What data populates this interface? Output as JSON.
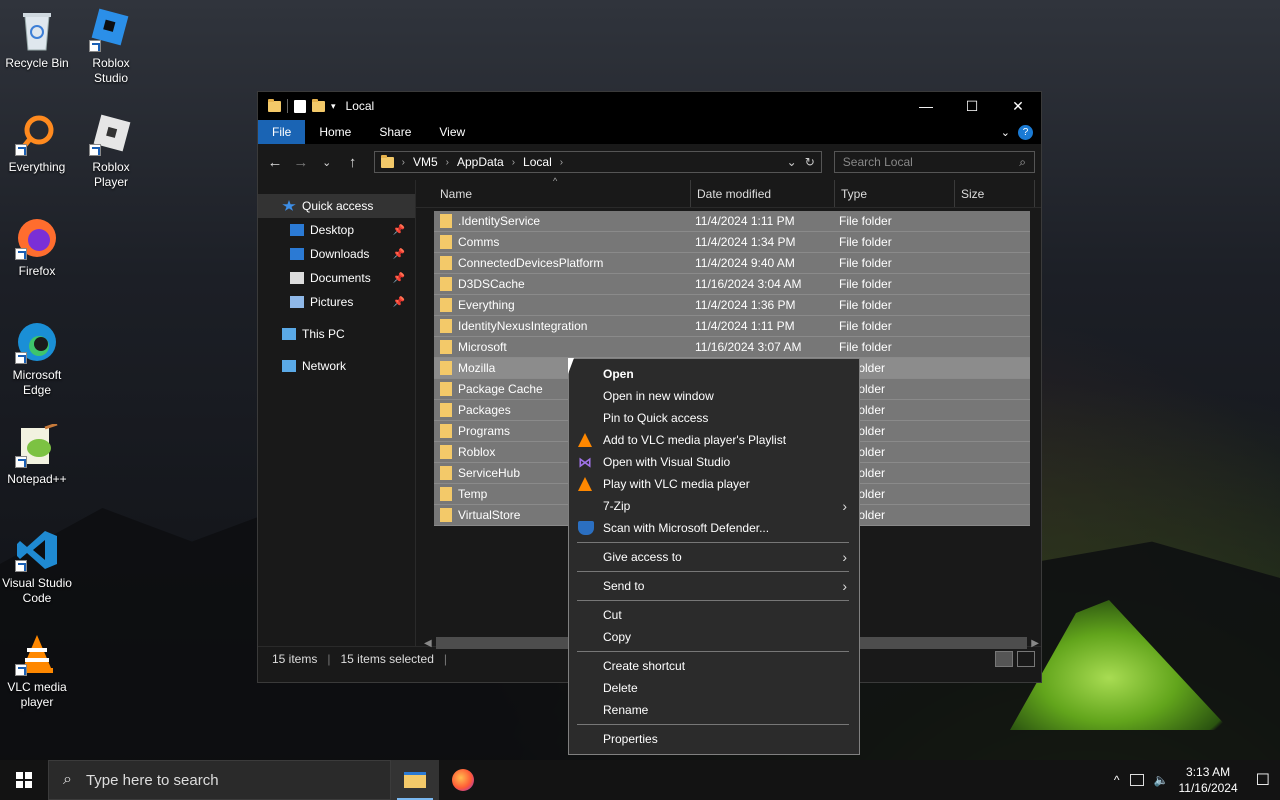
{
  "desktop": {
    "icons": [
      {
        "label": "Recycle Bin",
        "icon": "recycle-bin-icon"
      },
      {
        "label": "Roblox Studio",
        "icon": "roblox-studio-icon"
      },
      {
        "label": "Everything",
        "icon": "everything-icon"
      },
      {
        "label": "Roblox Player",
        "icon": "roblox-player-icon"
      },
      {
        "label": "Firefox",
        "icon": "firefox-icon"
      },
      {
        "label": "Microsoft Edge",
        "icon": "edge-icon"
      },
      {
        "label": "Notepad++",
        "icon": "notepadpp-icon"
      },
      {
        "label": "Visual Studio Code",
        "icon": "vscode-icon"
      },
      {
        "label": "VLC media player",
        "icon": "vlc-icon"
      }
    ]
  },
  "window": {
    "title": "Local",
    "controls": {
      "minimize": "—",
      "maximize": "☐",
      "close": "✕"
    },
    "ribbon": {
      "tabs": [
        "File",
        "Home",
        "Share",
        "View"
      ]
    },
    "nav": {
      "back": "←",
      "forward": "→",
      "recent": "⌄",
      "up": "↑"
    },
    "address": {
      "crumbs": [
        "VM5",
        "AppData",
        "Local"
      ],
      "dropdown": "⌄",
      "refresh": "↻"
    },
    "search": {
      "placeholder": "Search Local",
      "icon": "⌕"
    },
    "sidebar": {
      "items": [
        {
          "label": "Quick access",
          "icon": "star-icon",
          "pinned": false
        },
        {
          "label": "Desktop",
          "icon": "desktop-icon",
          "pinned": true
        },
        {
          "label": "Downloads",
          "icon": "download-icon",
          "pinned": true
        },
        {
          "label": "Documents",
          "icon": "documents-icon",
          "pinned": true
        },
        {
          "label": "Pictures",
          "icon": "pictures-icon",
          "pinned": true
        },
        {
          "label": "This PC",
          "icon": "pc-icon",
          "pinned": false
        },
        {
          "label": "Network",
          "icon": "network-icon",
          "pinned": false
        }
      ],
      "pin_glyph": "📌"
    },
    "columns": [
      "Name",
      "Date modified",
      "Type",
      "Size"
    ],
    "files": [
      {
        "name": ".IdentityService",
        "date": "11/4/2024 1:11 PM",
        "type": "File folder"
      },
      {
        "name": "Comms",
        "date": "11/4/2024 1:34 PM",
        "type": "File folder"
      },
      {
        "name": "ConnectedDevicesPlatform",
        "date": "11/4/2024 9:40 AM",
        "type": "File folder"
      },
      {
        "name": "D3DSCache",
        "date": "11/16/2024 3:04 AM",
        "type": "File folder"
      },
      {
        "name": "Everything",
        "date": "11/4/2024 1:36 PM",
        "type": "File folder"
      },
      {
        "name": "IdentityNexusIntegration",
        "date": "11/4/2024 1:11 PM",
        "type": "File folder"
      },
      {
        "name": "Microsoft",
        "date": "11/16/2024 3:07 AM",
        "type": "File folder"
      },
      {
        "name": "Mozilla",
        "date": "",
        "type": "folder"
      },
      {
        "name": "Package Cache",
        "date": "",
        "type": "folder"
      },
      {
        "name": "Packages",
        "date": "",
        "type": "folder"
      },
      {
        "name": "Programs",
        "date": "",
        "type": "folder"
      },
      {
        "name": "Roblox",
        "date": "",
        "type": "folder"
      },
      {
        "name": "ServiceHub",
        "date": "",
        "type": "folder"
      },
      {
        "name": "Temp",
        "date": "",
        "type": "folder"
      },
      {
        "name": "VirtualStore",
        "date": "",
        "type": "folder"
      }
    ],
    "status": {
      "count": "15 items",
      "selected": "15 items selected"
    }
  },
  "context_menu": {
    "items": [
      {
        "label": "Open",
        "bold": true
      },
      {
        "label": "Open in new window"
      },
      {
        "label": "Pin to Quick access"
      },
      {
        "label": "Add to VLC media player's Playlist",
        "icon": "vlc-icon"
      },
      {
        "label": "Open with Visual Studio",
        "icon": "visual-studio-icon"
      },
      {
        "label": "Play with VLC media player",
        "icon": "vlc-icon"
      },
      {
        "label": "7-Zip",
        "submenu": true
      },
      {
        "label": "Scan with Microsoft Defender...",
        "icon": "defender-shield-icon"
      },
      {
        "separator": true
      },
      {
        "label": "Give access to",
        "submenu": true
      },
      {
        "separator": true
      },
      {
        "label": "Send to",
        "submenu": true
      },
      {
        "separator": true
      },
      {
        "label": "Cut"
      },
      {
        "label": "Copy"
      },
      {
        "separator": true
      },
      {
        "label": "Create shortcut"
      },
      {
        "label": "Delete"
      },
      {
        "label": "Rename"
      },
      {
        "separator": true
      },
      {
        "label": "Properties"
      }
    ]
  },
  "taskbar": {
    "search_placeholder": "Type here to search",
    "time": "3:13 AM",
    "date": "11/16/2024",
    "tray_chevron": "^",
    "notification_glyph": "☐"
  }
}
